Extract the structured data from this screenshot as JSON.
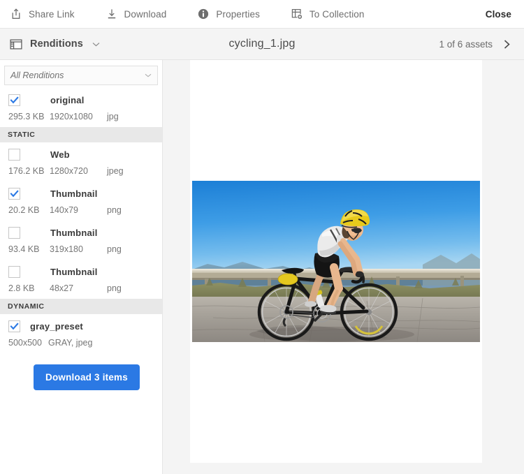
{
  "toolbar": {
    "items": [
      {
        "label": "Share Link",
        "icon": "share-link-icon"
      },
      {
        "label": "Download",
        "icon": "download-icon"
      },
      {
        "label": "Properties",
        "icon": "info-icon"
      },
      {
        "label": "To Collection",
        "icon": "add-to-collection-icon"
      }
    ],
    "close_label": "Close"
  },
  "header": {
    "panel_title": "Renditions",
    "panel_icon": "renditions-icon",
    "chevron_icon": "chevron-down-icon",
    "asset_name": "cycling_1.jpg",
    "asset_count": "1 of 6 assets",
    "next_icon": "chevron-right-icon"
  },
  "sidebar": {
    "filter": {
      "value": "All Renditions",
      "placeholder": "All Renditions",
      "chevron_icon": "chevron-down-icon"
    },
    "renditions": [
      {
        "name": "original",
        "checked": true,
        "size": "295.3 KB",
        "dimensions": "1920x1080",
        "format": "jpg",
        "indent": "wide"
      }
    ],
    "groups": [
      {
        "title": "STATIC",
        "renditions": [
          {
            "name": "Web",
            "checked": false,
            "size": "176.2 KB",
            "dimensions": "1280x720",
            "format": "jpeg",
            "indent": "wide"
          },
          {
            "name": "Thumbnail",
            "checked": true,
            "size": "20.2 KB",
            "dimensions": "140x79",
            "format": "png",
            "indent": "wide"
          },
          {
            "name": "Thumbnail",
            "checked": false,
            "size": "93.4 KB",
            "dimensions": "319x180",
            "format": "png",
            "indent": "wide"
          },
          {
            "name": "Thumbnail",
            "checked": false,
            "size": "2.8 KB",
            "dimensions": "48x27",
            "format": "png",
            "indent": "wide"
          }
        ]
      },
      {
        "title": "DYNAMIC",
        "renditions": [
          {
            "name": "gray_preset",
            "checked": true,
            "size": "500x500",
            "dimensions": "GRAY, jpeg",
            "format": "",
            "indent": "narrow"
          }
        ]
      }
    ],
    "download_button": "Download 3 items"
  },
  "preview": {
    "alt": "Cyclist in white jersey and yellow helmet riding a black road bike on a mountain road under a clear blue sky"
  },
  "colors": {
    "accent": "#2b79e4",
    "check": "#2b79e4",
    "group_header_bg": "#e8e8e8",
    "page_bg": "#f4f4f4"
  }
}
